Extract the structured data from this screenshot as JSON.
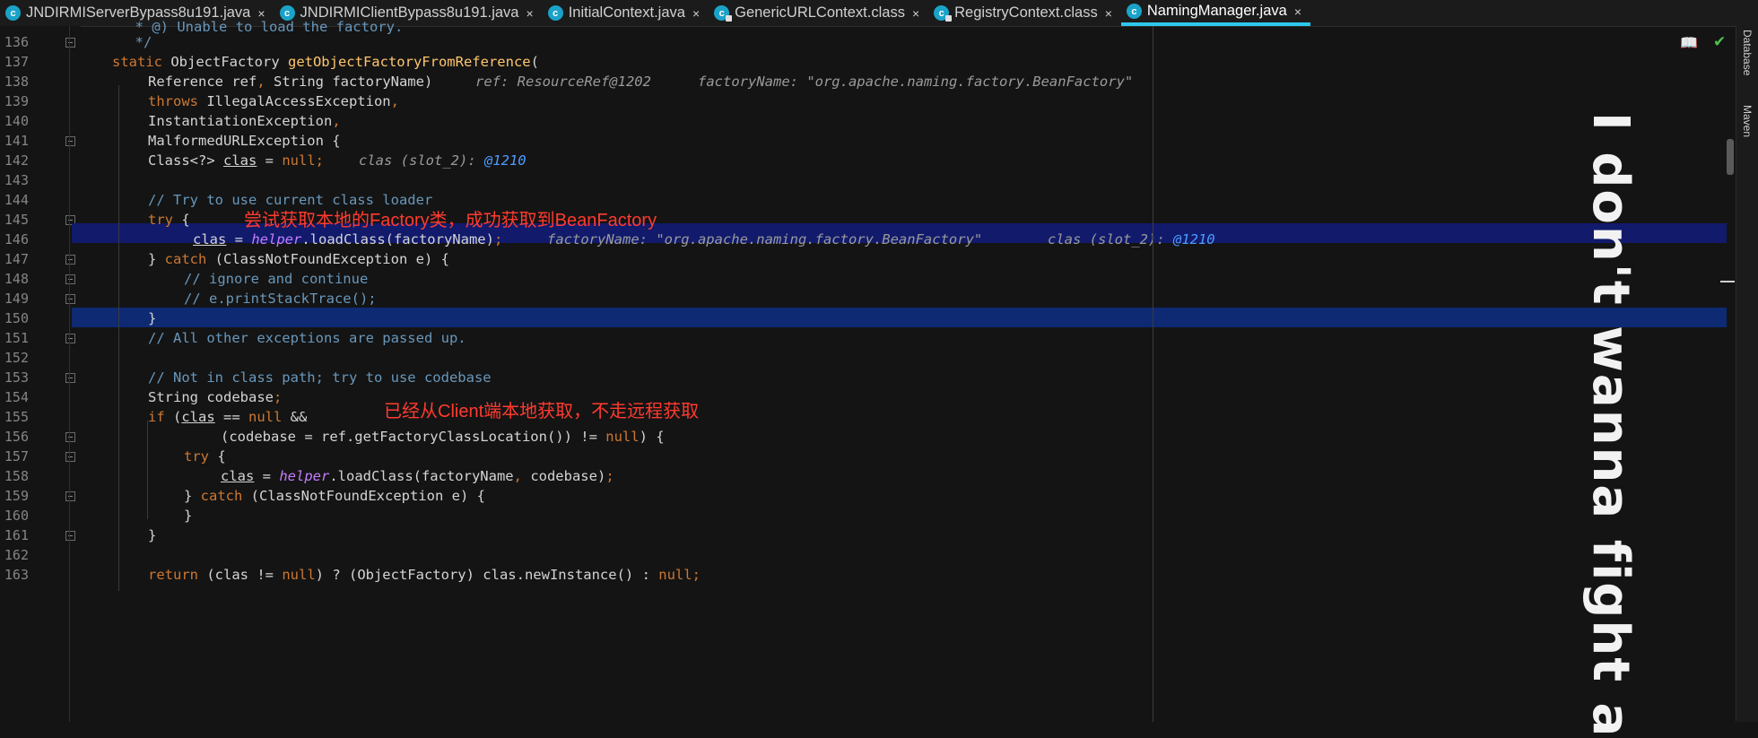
{
  "tabs": [
    {
      "label": "JNDIRMIServerBypass8u191.java",
      "icon": "java-class-icon",
      "locked": false,
      "active": false
    },
    {
      "label": "JNDIRMIClientBypass8u191.java",
      "icon": "java-class-icon",
      "locked": false,
      "active": false
    },
    {
      "label": "InitialContext.java",
      "icon": "java-class-icon",
      "locked": false,
      "active": false
    },
    {
      "label": "GenericURLContext.class",
      "icon": "java-class-icon",
      "locked": true,
      "active": false
    },
    {
      "label": "RegistryContext.class",
      "icon": "java-class-icon",
      "locked": true,
      "active": false
    },
    {
      "label": "NamingManager.java",
      "icon": "java-class-icon",
      "locked": false,
      "active": true
    }
  ],
  "tab_close_glyph": "×",
  "line_numbers": [
    "136",
    "137",
    "138",
    "139",
    "140",
    "141",
    "142",
    "143",
    "144",
    "145",
    "146",
    "147",
    "148",
    "149",
    "150",
    "151",
    "152",
    "153",
    "154",
    "155",
    "156",
    "157",
    "158",
    "159",
    "160",
    "161",
    "162",
    "163"
  ],
  "code": {
    "l135": "* @) Unable to load the factory.",
    "l136": "*/",
    "l137_kw": "static",
    "l137_type": " ObjectFactory ",
    "l137_fn": "getObjectFactoryFromReference",
    "l137_rest": "(",
    "l138_a": "Reference ref",
    "l138_b": ", ",
    "l138_c": "String factoryName)",
    "l138_inline1": "ref: ResourceRef@1202",
    "l138_inline2": "factoryName: \"org.apache.naming.factory.BeanFactory\"",
    "l139_kw": "throws",
    "l139_rest": " IllegalAccessException",
    "l139_comma": ",",
    "l140": "InstantiationException",
    "l140_comma": ",",
    "l141": "MalformedURLException {",
    "l142_a": "Class<?> ",
    "l142_var": "clas",
    "l142_b": " = ",
    "l142_null": "null",
    "l142_semi": ";",
    "l142_inline": "clas (slot_2): ",
    "l142_inline_num": "@1210",
    "l144": "// Try to use current class loader",
    "l145_kw": "try",
    "l145_rest": " {",
    "l146_var": "clas",
    "l146_eq": " = ",
    "l146_helper": "helper",
    "l146_rest": ".loadClass(factoryName)",
    "l146_semi": ";",
    "l146_inline1": "factoryName: \"org.apache.naming.factory.BeanFactory\"",
    "l146_inline2": "clas (slot_2): ",
    "l146_inline_num": "@1210",
    "l147_a": "} ",
    "l147_kw": "catch",
    "l147_rest": " (ClassNotFoundException e) {",
    "l148": "// ignore and continue",
    "l149": "// e.printStackTrace();",
    "l150": "}",
    "l151": "// All other exceptions are passed up.",
    "l153": "// Not in class path; try to use codebase",
    "l154_a": "String codebase",
    "l154_semi": ";",
    "l155_kw": "if",
    "l155_a": " (",
    "l155_var": "clas",
    "l155_b": " == ",
    "l155_null": "null",
    "l155_c": " &&",
    "l156_a": "(codebase = ref.getFactoryClassLocation()) != ",
    "l156_null": "null",
    "l156_b": ") {",
    "l157_kw": "try",
    "l157_rest": " {",
    "l158_var": "clas",
    "l158_eq": " = ",
    "l158_helper": "helper",
    "l158_rest": ".loadClass(factoryName",
    "l158_comma": ", ",
    "l158_end": "codebase)",
    "l158_semi": ";",
    "l159_a": "} ",
    "l159_kw": "catch",
    "l159_rest": " (ClassNotFoundException e) {",
    "l160": "}",
    "l161": "}",
    "l163_kw": "return",
    "l163_a": " (clas != ",
    "l163_null": "null",
    "l163_b": ") ? (ObjectFactory) clas.newInstance() : ",
    "l163_null2": "null",
    "l163_semi": ";"
  },
  "annotations": {
    "note1": "尝试获取本地的Factory类，成功获取到BeanFactory",
    "note2": "已经从Client端本地获取，不走远程获取"
  },
  "watermark": "I don't wanna fight a",
  "sidebar": {
    "database": "Database",
    "maven": "Maven"
  },
  "colors": {
    "keyword": "#cc7832",
    "function": "#ffc66d",
    "comment": "#6897bb",
    "annotation": "#ff3b30",
    "exec_line": "#111a6b",
    "selected_line": "#0e2a73",
    "tab_accent": "#2ec8ee"
  }
}
